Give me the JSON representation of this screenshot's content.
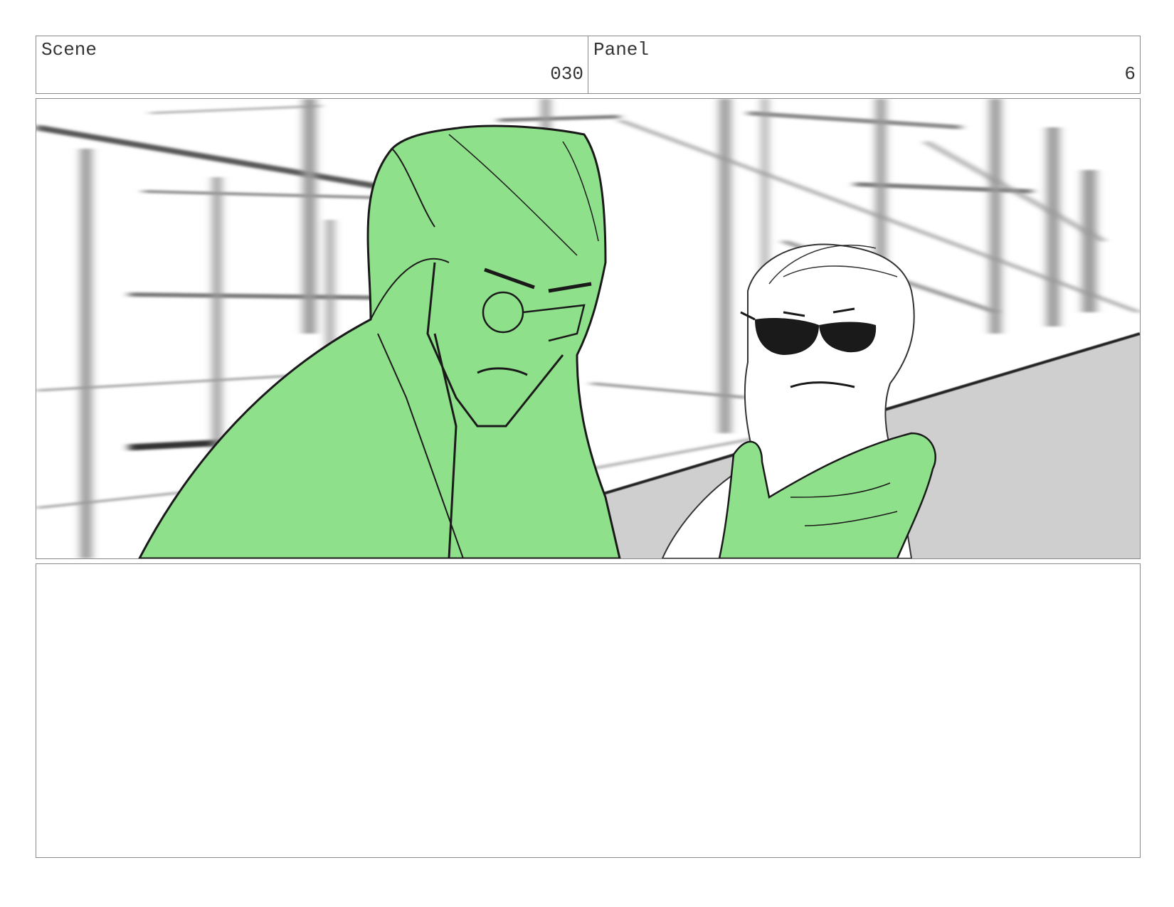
{
  "scene": {
    "label": "Scene",
    "number": "030"
  },
  "panel": {
    "label": "Panel",
    "number": "6"
  },
  "notes": {
    "text": ""
  },
  "colors": {
    "highlight_green": "#8fe08a",
    "line": "#1a1a1a",
    "floor_gray": "#cfcfcf"
  },
  "artwork": {
    "description_icon": "storyboard-sketch-image"
  }
}
